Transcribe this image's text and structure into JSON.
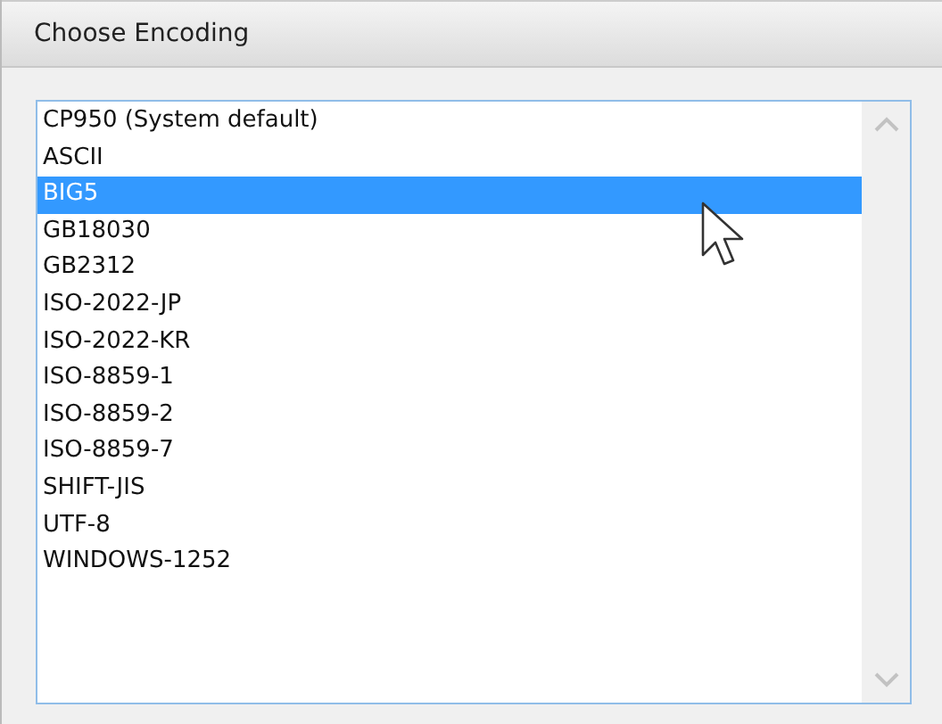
{
  "window": {
    "title": "Choose Encoding"
  },
  "list": {
    "items": [
      {
        "label": "CP950 (System default)",
        "selected": false
      },
      {
        "label": "ASCII",
        "selected": false
      },
      {
        "label": "BIG5",
        "selected": true
      },
      {
        "label": "GB18030",
        "selected": false
      },
      {
        "label": "GB2312",
        "selected": false
      },
      {
        "label": "ISO-2022-JP",
        "selected": false
      },
      {
        "label": "ISO-2022-KR",
        "selected": false
      },
      {
        "label": "ISO-8859-1",
        "selected": false
      },
      {
        "label": "ISO-8859-2",
        "selected": false
      },
      {
        "label": "ISO-8859-7",
        "selected": false
      },
      {
        "label": "SHIFT-JIS",
        "selected": false
      },
      {
        "label": "UTF-8",
        "selected": false
      },
      {
        "label": "WINDOWS-1252",
        "selected": false
      }
    ]
  }
}
